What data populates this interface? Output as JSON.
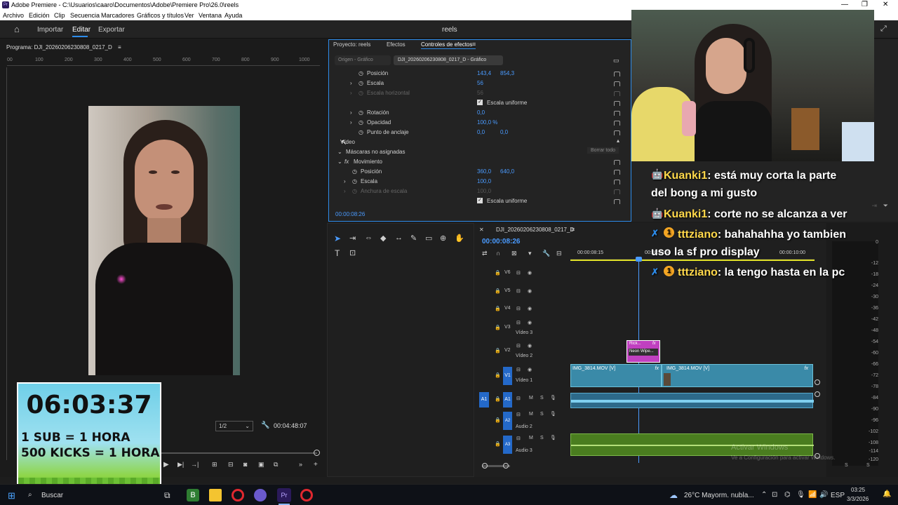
{
  "window": {
    "title": "Adobe Premiere - C:\\Usuarios\\caaro\\Documentos\\Adobe\\Premiere Pro\\26.0\\reels"
  },
  "menu": [
    "Archivo",
    "Edición",
    "Clip",
    "Secuencia",
    "Marcadores",
    "Gráficos y títulos",
    "Ver",
    "Ventana",
    "Ayuda"
  ],
  "toolbar": {
    "import": "Importar",
    "edit": "Editar",
    "export": "Exportar",
    "project_name": "reels"
  },
  "program": {
    "title": "Programa: DJI_20260206230808_0217_D",
    "menu_icon": "≡",
    "ruler_labels": [
      "00",
      "100",
      "200",
      "300",
      "400",
      "500",
      "600",
      "700",
      "800",
      "900",
      "1000"
    ],
    "resolution": "1/2",
    "duration": "00:04:48:07"
  },
  "effects_panel": {
    "tabs": [
      "Proyecto: reels",
      "Efectos",
      "Controles de efectos"
    ],
    "source_tab": "Origen - Gráfico",
    "active_clip": "DJI_20260206230808_0217_D - Gráfico",
    "rows": {
      "posicion_label": "Posición",
      "posicion_x": "143,4",
      "posicion_y": "854,3",
      "escala_label": "Escala",
      "escala_val": "56",
      "escala_h_label": "Escala horizontal",
      "escala_h_val": "56",
      "escala_uniforme": "Escala uniforme",
      "rotacion_label": "Rotación",
      "rotacion_val": "0,0",
      "opacidad_label": "Opacidad",
      "opacidad_val": "100,0 %",
      "anclaje_label": "Punto de anclaje",
      "anclaje_x": "0,0",
      "anclaje_y": "0,0",
      "video_label": "Vídeo",
      "mascaras_label": "Máscaras no asignadas",
      "borrar_todo": "Borrar todo",
      "movimiento_label": "Movimiento",
      "posicion2_label": "Posición",
      "posicion2_x": "360,0",
      "posicion2_y": "640,0",
      "escala2_label": "Escala",
      "escala2_val": "100,0",
      "anchura_label": "Anchura de escala",
      "anchura_val": "100,0",
      "escala_uniforme2": "Escala uniforme"
    },
    "timecode": "00:00:08:26"
  },
  "timeline": {
    "sequence_name": "DJI_20260206230808_0217_D",
    "timecode": "00:00:08:26",
    "ruler": [
      "00:00:08:15",
      "00:00:09:00",
      "00:00:10:00"
    ],
    "tracks": [
      {
        "id": "V6",
        "name": ""
      },
      {
        "id": "V5",
        "name": ""
      },
      {
        "id": "V4",
        "name": ""
      },
      {
        "id": "V3",
        "name": "Vídeo 3"
      },
      {
        "id": "V2",
        "name": "Vídeo 2"
      },
      {
        "id": "V1",
        "name": "Vídeo 1"
      },
      {
        "id": "A1",
        "name": ""
      },
      {
        "id": "A2",
        "name": "Audio 2"
      },
      {
        "id": "A3",
        "name": "Audio 3"
      }
    ],
    "clips": {
      "v1_a": "IMG_3814.MOV [V]",
      "v1_b": "IMG_3814.MOV [V]",
      "v2_title": "Rick...",
      "v2_sub": "Neon Wipe...",
      "fx": "fx"
    },
    "source_patch": "A1",
    "v1_patch": "V1",
    "mute_label": "M",
    "solo_label": "S"
  },
  "meter_ticks": [
    "0",
    "-12",
    "-18",
    "-24",
    "-30",
    "-36",
    "-42",
    "-48",
    "-54",
    "-60",
    "-66",
    "-72",
    "-78",
    "-84",
    "-90",
    "-96",
    "-102",
    "-108",
    "-114",
    "-120"
  ],
  "meter_footer": [
    "S",
    "S"
  ],
  "chat": [
    {
      "user": "Kuanki1",
      "text": ": está muy corta la parte del bong a mi gusto"
    },
    {
      "user": "Kuanki1",
      "text": ": corte no se alcanza a ver"
    },
    {
      "user": "tttziano",
      "text": ": bahahahha yo tambien uso la sf pro display"
    },
    {
      "user": "tttziano",
      "text": ": la tengo hasta en la pc"
    }
  ],
  "timer": {
    "time": "06:03:37",
    "line1": "1 SUB = 1 HORA",
    "line2": "500 KICKS = 1 HORA"
  },
  "watermark": {
    "line1": "Activar Windows",
    "line2": "Ve a Configuración para activar Windows."
  },
  "taskbar": {
    "search": "Buscar",
    "weather": "26°C  Mayorm. nubla...",
    "lang": "ESP",
    "time": "03:25",
    "date": "3/3/2026"
  },
  "colors": {
    "accent_blue": "#2d8ceb",
    "value_blue": "#4a9bff",
    "clip_teal": "#3a8aa8",
    "clip_green": "#4a7d1f",
    "clip_pink": "#c040c0",
    "track_patch": "#2469c9"
  }
}
